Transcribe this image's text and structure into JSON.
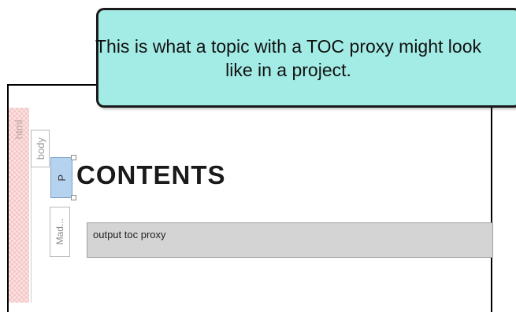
{
  "callout": {
    "text": "This is what a topic with a TOC proxy might look like in a project."
  },
  "structure_bars": {
    "html_label": "html",
    "body_label": "body",
    "mad_label": "Mad...",
    "p_label": "P"
  },
  "editor": {
    "heading": "CONTENTS",
    "proxy_label": "output toc proxy"
  },
  "colors": {
    "callout_bg": "#a3ece6",
    "p_tag_bg": "#b5d3ef",
    "html_bar_bg": "#fbe0e0",
    "proxy_bg": "#d4d4d4"
  }
}
